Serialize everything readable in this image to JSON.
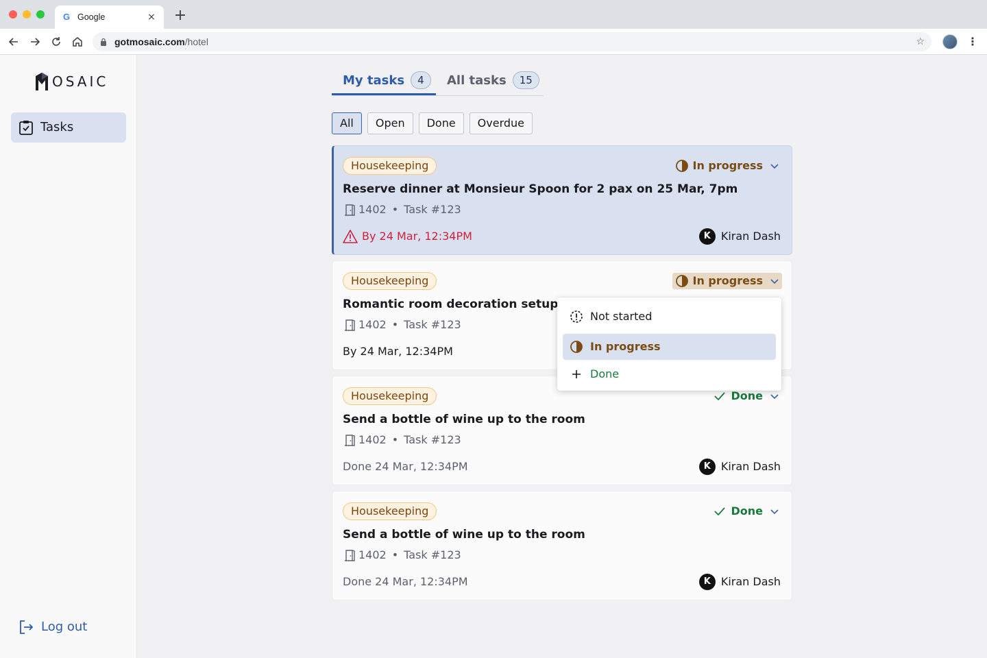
{
  "browser": {
    "tab_title": "Google",
    "tab_favicon": "G",
    "tab_close": "×",
    "new_tab": "+",
    "url_host": "gotmosaic.com",
    "url_path": "/hotel",
    "star": "☆",
    "menu": "⋮"
  },
  "sidebar": {
    "logo_text": "OSAIC",
    "nav_label": "Tasks",
    "logout_label": "Log out"
  },
  "tabs": [
    {
      "label": "My tasks",
      "count": "4"
    },
    {
      "label": "All tasks",
      "count": "15"
    }
  ],
  "filters": [
    "All",
    "Open",
    "Done",
    "Overdue"
  ],
  "cards": [
    {
      "category": "Housekeeping",
      "status": "In progress",
      "title": "Reserve dinner at Monsieur Spoon for 2 pax on 25 Mar, 7pm",
      "room": "1402",
      "separator": "•",
      "task": "Task #123",
      "due": "By 24 Mar, 12:34PM",
      "assignee_initial": "K",
      "assignee": "Kiran Dash"
    },
    {
      "category": "Housekeeping",
      "status": "In progress",
      "title": "Romantic room decoration setup",
      "room": "1402",
      "separator": "•",
      "task": "Task #123",
      "due": "By 24 Mar, 12:34PM"
    },
    {
      "category": "Housekeeping",
      "status": "Done",
      "title": "Send a bottle of wine up to the room",
      "room": "1402",
      "separator": "•",
      "task": "Task #123",
      "due": "Done 24 Mar, 12:34PM",
      "assignee_initial": "K",
      "assignee": "Kiran Dash"
    },
    {
      "category": "Housekeeping",
      "status": "Done",
      "title": "Send a bottle of wine up to the room",
      "room": "1402",
      "separator": "•",
      "task": "Task #123",
      "due": "Done 24 Mar, 12:34PM",
      "assignee_initial": "K",
      "assignee": "Kiran Dash"
    }
  ],
  "status_menu": [
    {
      "label": "Not started",
      "icon": "not-started-icon"
    },
    {
      "label": "In progress",
      "icon": "in-progress-icon"
    },
    {
      "label": "Done",
      "icon": "plus-icon"
    }
  ],
  "colors": {
    "accent": "#2c5cab",
    "selected_bg": "#d9e0f0",
    "overdue": "#d1213b",
    "in_progress": "#7a4c13",
    "done": "#197a3c"
  }
}
